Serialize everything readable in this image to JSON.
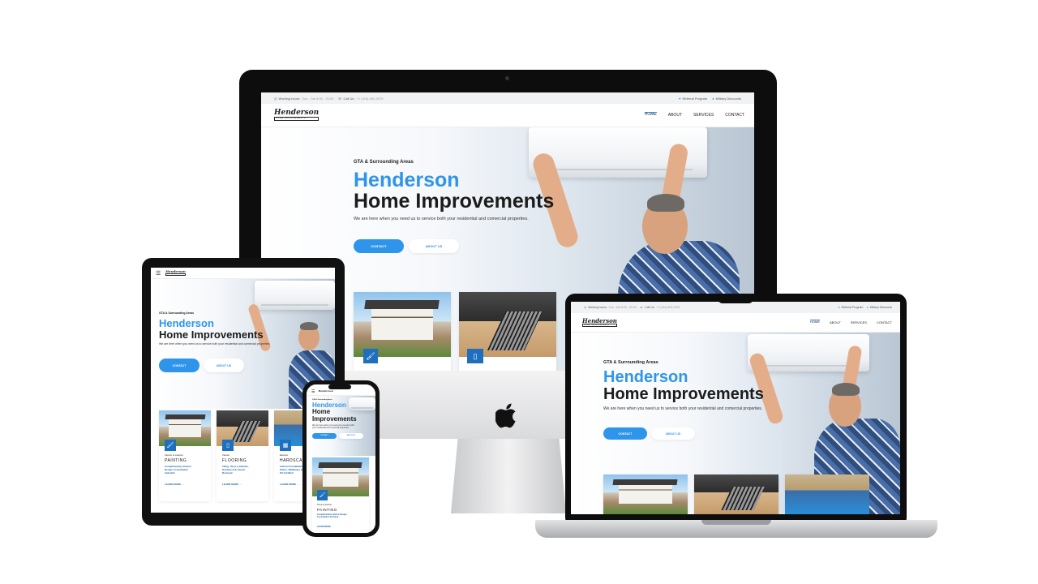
{
  "site": {
    "topbar": {
      "hours_label": "Working hours:",
      "hours_value": "Sun - Sat 8:00 - 20:00",
      "call_label": "Call Us:",
      "call_value": "+1 (416) 800-9975",
      "call_value_short": "+1 (416) 800-9975",
      "referral": "Referral Program",
      "military": "Military Discounts"
    },
    "logo": {
      "main": "Henderson",
      "sub": "HOME IMPROVEMENTS"
    },
    "nav": {
      "home": "HOME",
      "about": "ABOUT",
      "services": "SERVICES",
      "contact": "CONTACT"
    },
    "hero": {
      "kicker": "GTA & Surrounding Areas",
      "kicker_tablet": "GTA & Surrounding Areas",
      "title_blue": "Henderson",
      "title_dark": "Home Improvements",
      "phone_title_dark_1": "Home",
      "phone_title_dark_2": "Improvements",
      "tagline": "We are here when you need us to service both your residential and comercial properties.",
      "phone_tagline": "We are here when you need us to service both your residential and comercial properties.",
      "contact_btn": "CONTACT",
      "about_btn": "ABOUT US"
    },
    "cards": [
      {
        "small": "Interior & exterior",
        "title": "PAINTING",
        "list": [
          "Complimentary Interior",
          "Design Consultation",
          "Included"
        ],
        "link": "LEARN MORE"
      },
      {
        "small": "Interior",
        "title": "FLOORING",
        "list": [
          "Tiling, Vinyl, Laminate,",
          "Hardwood & Carpet",
          "Removal"
        ],
        "link": "LEARN MORE"
      },
      {
        "small": "Exterior",
        "title": "HARDSCAPING",
        "list": [
          "Interlock Installation,",
          "Patios, Walkways &",
          "ICI Certified"
        ],
        "link": "LEARN MORE"
      }
    ],
    "phone_card": {
      "small": "Home & exterior",
      "title": "PAINTING",
      "list": [
        "Complimentary Interior Design",
        "Consultation Included"
      ],
      "link": "LEARN MORE"
    }
  },
  "icons": {
    "menu": "menu-icon",
    "apple": "apple-logo-icon",
    "heart": "heart-icon",
    "clock": "clock-icon",
    "phone": "phone-icon",
    "paint_roller": "paint-roller-icon",
    "door": "door-icon",
    "grid": "grid-icon"
  },
  "colors": {
    "accent": "#2f95ea",
    "dark": "#1c1c1c",
    "badge": "#1f6fbf"
  }
}
